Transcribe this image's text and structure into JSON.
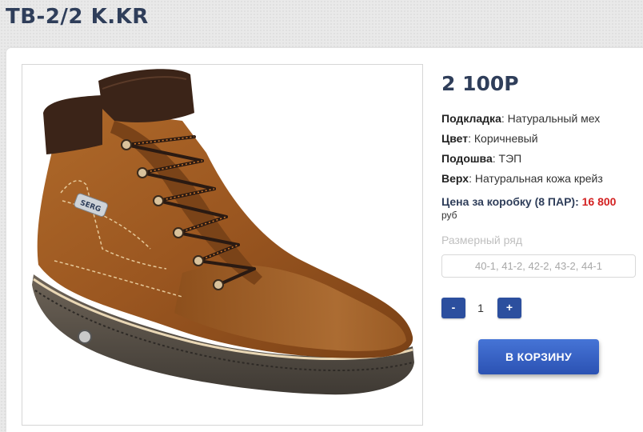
{
  "product": {
    "title": "TB-2/2 K.KR",
    "price": "2 100Р",
    "image_alt": "boot-photo",
    "specs": [
      {
        "label": "Подкладка",
        "value": ": Натуральный мех"
      },
      {
        "label": "Цвет",
        "value": ": Коричневый"
      },
      {
        "label": "Подошва",
        "value": ": ТЭП"
      },
      {
        "label": "Верх",
        "value": ": Натуральная кожа крейз"
      }
    ],
    "box_price_label": "Цена за коробку (8 ПАР): ",
    "box_price_value": "16 800",
    "box_price_currency": "руб",
    "size_label": "Размерный ряд",
    "size_value": "40-1, 41-2, 42-2, 43-2, 44-1",
    "boot_brand_tag": "SERG"
  },
  "quantity": {
    "minus": "-",
    "value": "1",
    "plus": "+"
  },
  "cart": {
    "button_label": "В КОРЗИНУ"
  },
  "colors": {
    "title": "#2f3e5a",
    "accent": "#2c4f9e",
    "price_highlight": "#d32121"
  }
}
